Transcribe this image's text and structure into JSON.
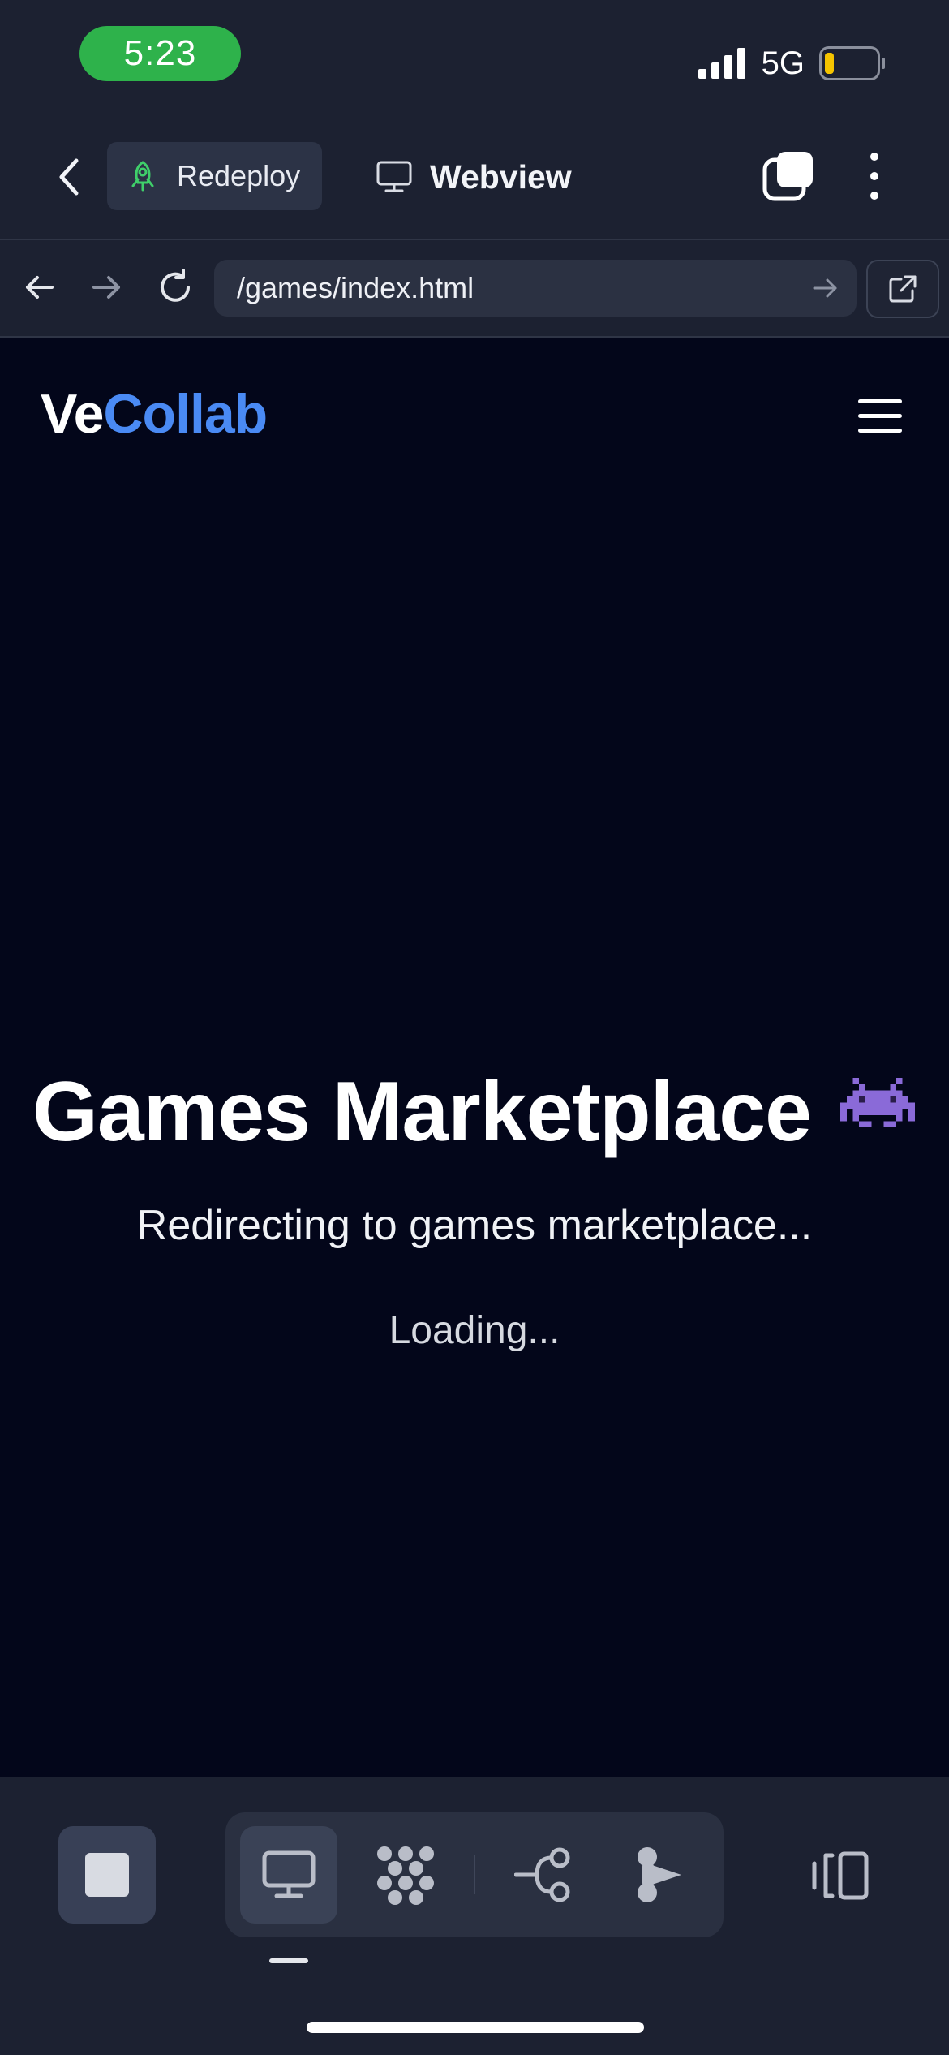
{
  "status_bar": {
    "time": "5:23",
    "network": "5G",
    "battery_level": 0.12,
    "battery_color": "#f5c400"
  },
  "header": {
    "redeploy_label": "Redeploy",
    "redeploy_icon": "rocket-icon",
    "webview_label": "Webview",
    "webview_icon": "monitor-icon"
  },
  "urlbar": {
    "url": "/games/index.html"
  },
  "page": {
    "brand_ve": "Ve",
    "brand_collab": "Collab",
    "brand_accent_color": "#4a8af4",
    "headline": "Games Marketplace",
    "headline_emoji": "alien-monster-icon",
    "subtext": "Redirecting to games marketplace...",
    "loading": "Loading..."
  },
  "toolbar": {
    "items": [
      "stop-icon",
      "monitor-icon",
      "grid-dots-icon",
      "git-branch-icon",
      "agent-icon",
      "panel-toggle-icon"
    ],
    "active": "monitor-icon"
  },
  "colors": {
    "app_bg": "#1c2131",
    "page_bg": "#03061a",
    "status_pill": "#2eb24b"
  }
}
